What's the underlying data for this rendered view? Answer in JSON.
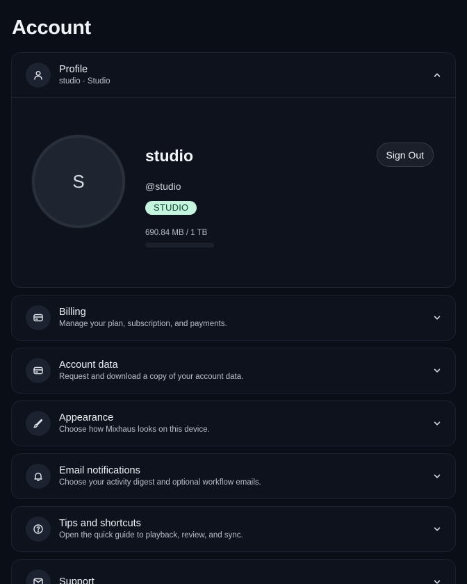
{
  "page": {
    "title": "Account"
  },
  "profile": {
    "title": "Profile",
    "subtitle": "studio · Studio",
    "avatar_initial": "S",
    "username": "studio",
    "handle": "@studio",
    "plan_badge": "STUDIO",
    "storage_text": "690.84 MB / 1 TB",
    "storage_used_fraction": 0.0007,
    "sign_out_label": "Sign Out",
    "icon": "user-icon",
    "expanded": true
  },
  "sections": [
    {
      "id": "billing",
      "title": "Billing",
      "subtitle": "Manage your plan, subscription, and payments.",
      "icon": "credit-card-icon"
    },
    {
      "id": "account-data",
      "title": "Account data",
      "subtitle": "Request and download a copy of your account data.",
      "icon": "credit-card-icon"
    },
    {
      "id": "appearance",
      "title": "Appearance",
      "subtitle": "Choose how Mixhaus looks on this device.",
      "icon": "brush-icon"
    },
    {
      "id": "email-notifications",
      "title": "Email notifications",
      "subtitle": "Choose your activity digest and optional workflow emails.",
      "icon": "bell-icon"
    },
    {
      "id": "tips-shortcuts",
      "title": "Tips and shortcuts",
      "subtitle": "Open the quick guide to playback, review, and sync.",
      "icon": "help-circle-icon"
    },
    {
      "id": "support",
      "title": "Support",
      "subtitle": "",
      "icon": "mail-icon"
    }
  ],
  "colors": {
    "background": "#0a0e16",
    "card": "#0d121c",
    "border": "#1c2330",
    "badge_bg": "#c5f5de",
    "badge_text": "#0e4a33"
  }
}
